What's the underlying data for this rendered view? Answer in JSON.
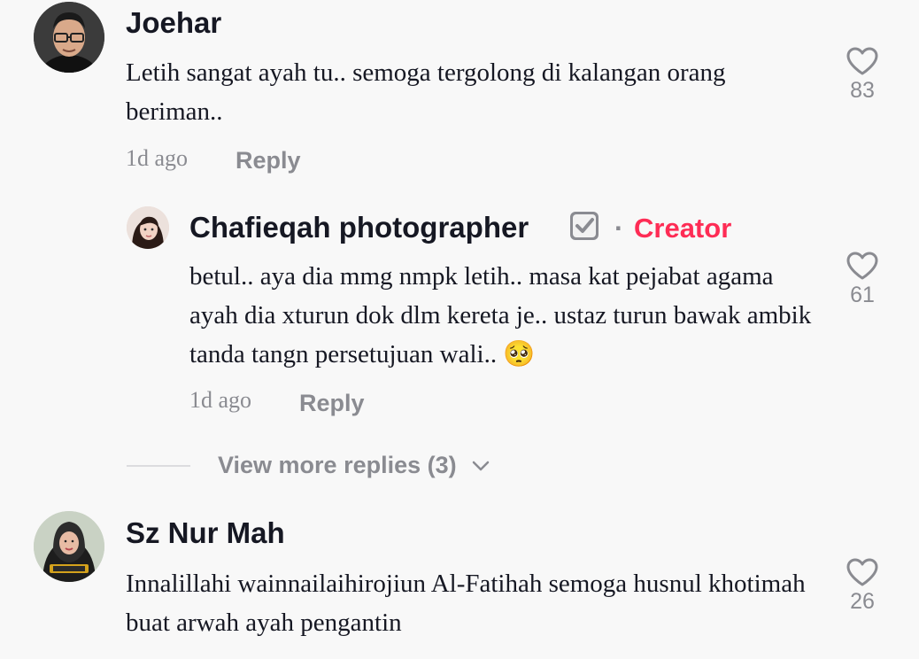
{
  "comments": [
    {
      "username": "Joehar",
      "text": "Letih sangat ayah tu.. semoga tergolong di kalangan orang beriman..",
      "time": "1d ago",
      "reply_label": "Reply",
      "likes": "83",
      "replies": [
        {
          "username": "Chafieqah photographer",
          "verified": true,
          "creator_separator": "·",
          "creator_label": "Creator",
          "text": "betul.. aya dia mmg nmpk letih.. masa kat pejabat agama ayah dia xturun dok dlm kereta je.. ustaz turun bawak ambik tanda tangn persetujuan wali.. 🥺",
          "time": "1d ago",
          "reply_label": "Reply",
          "likes": "61"
        }
      ],
      "view_more_label": "View more replies (3)"
    },
    {
      "username": "Sz Nur Mah",
      "text": "Innalillahi wainnailaihirojiun Al-Fatihah semoga husnul khotimah buat arwah ayah pengantin",
      "likes": "26"
    }
  ],
  "colors": {
    "background": "#f8f8f8",
    "creator": "#fe2c55",
    "secondary_text": "#8a8b91"
  }
}
